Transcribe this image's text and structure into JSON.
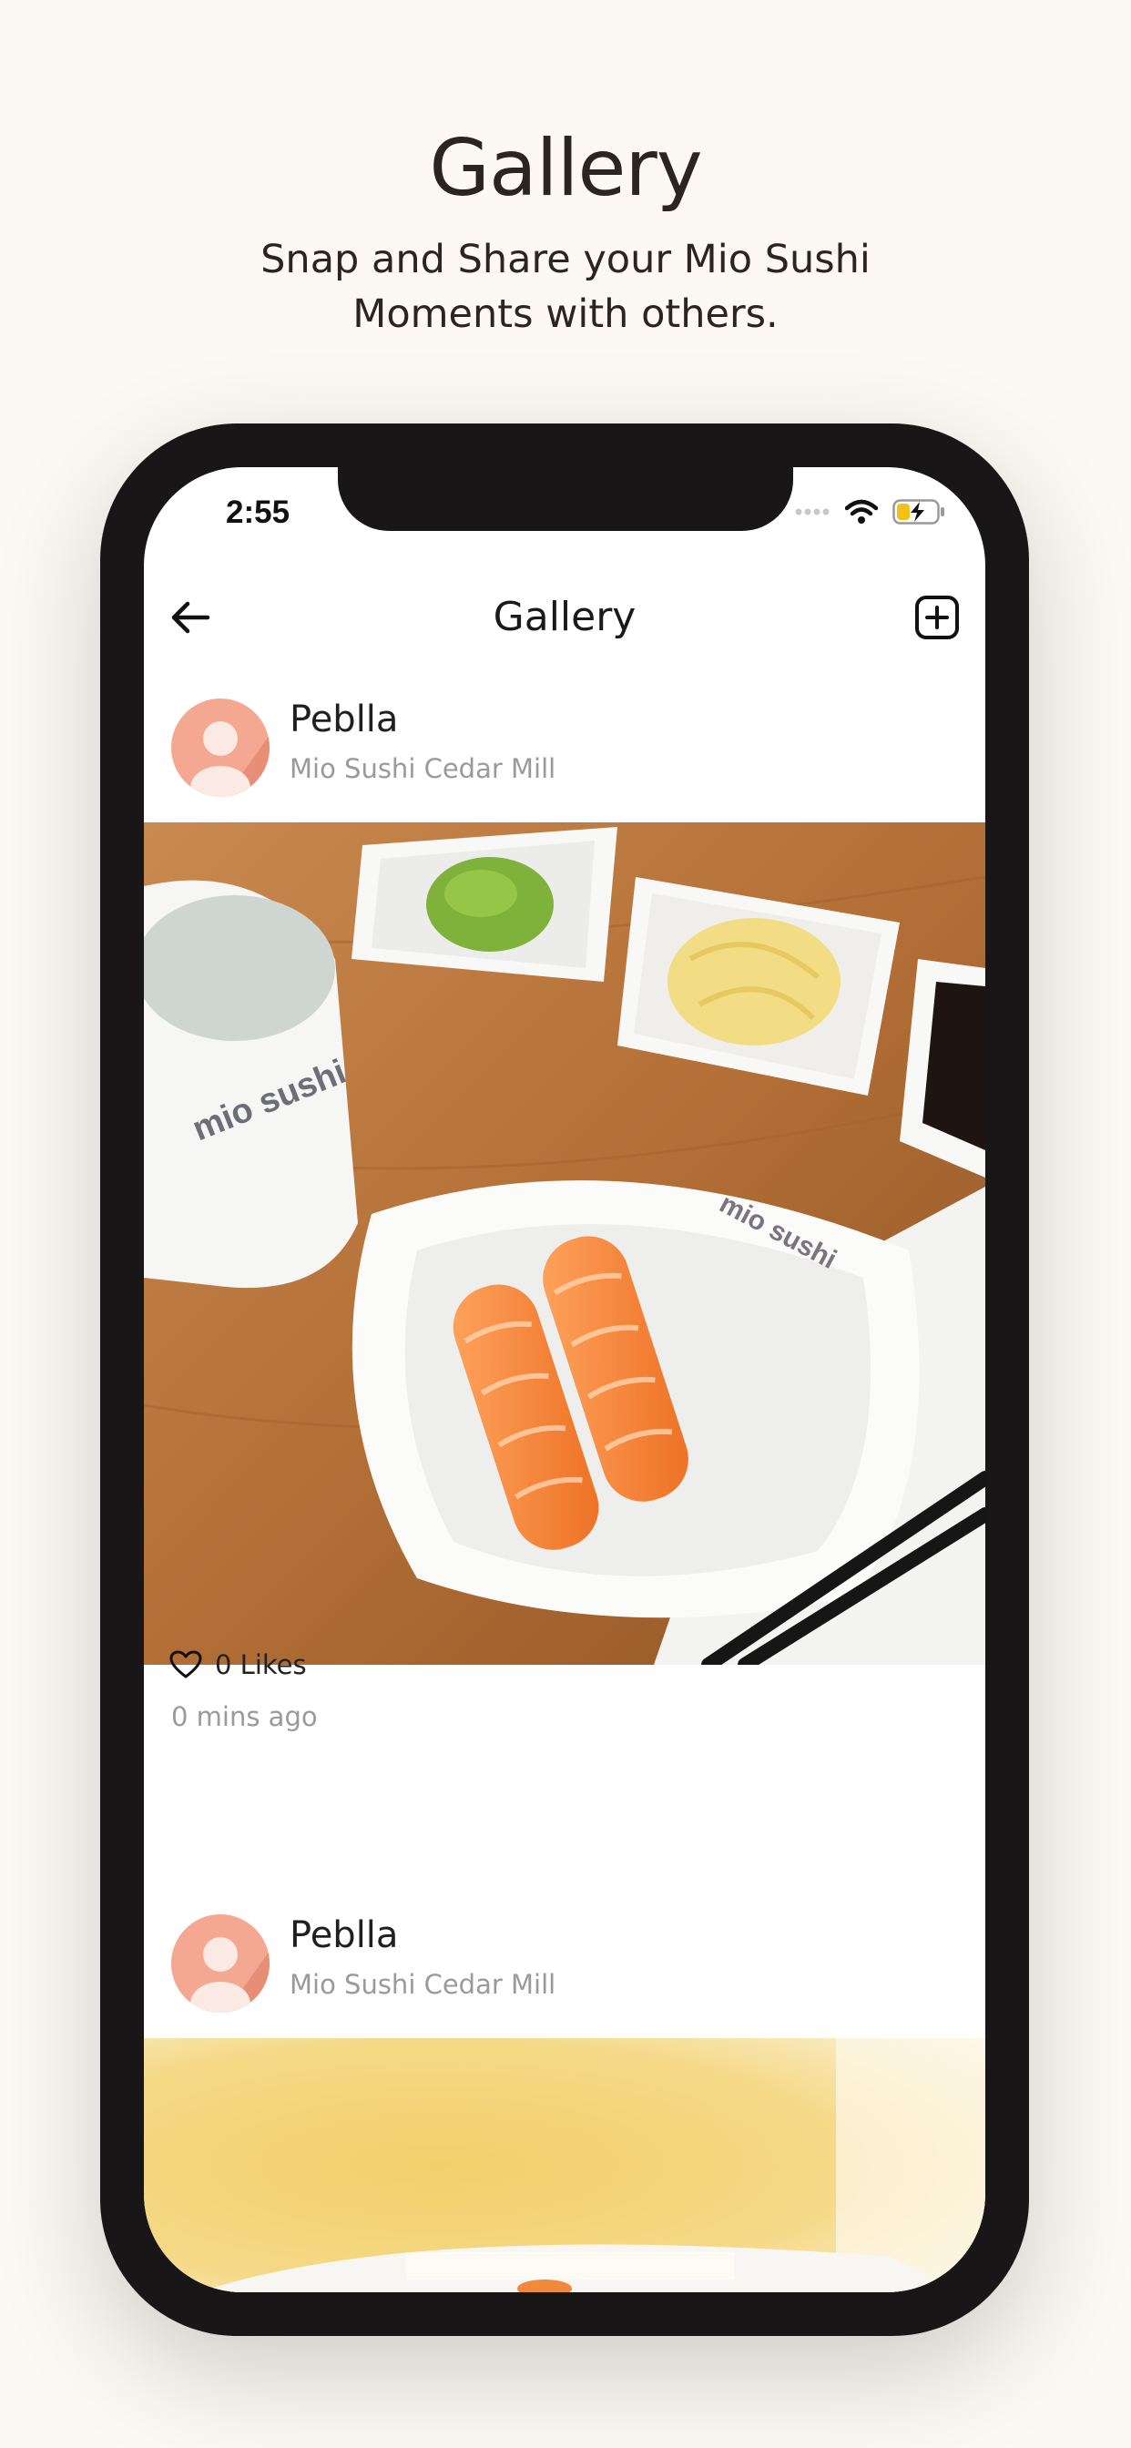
{
  "promo": {
    "title": "Gallery",
    "subtitle_line1": "Snap and Share your Mio Sushi",
    "subtitle_line2": "Moments with others."
  },
  "status_bar": {
    "time": "2:55"
  },
  "nav": {
    "title": "Gallery",
    "back_icon": "arrow-left-icon",
    "add_icon": "plus-square-icon"
  },
  "posts": [
    {
      "user": "Peblla",
      "location": "Mio Sushi Cedar Mill",
      "likes": "0 Likes",
      "time_ago": "0 mins ago",
      "photo_brand_text": "mio sushi"
    },
    {
      "user": "Peblla",
      "location": "Mio Sushi Cedar Mill"
    }
  ],
  "colors": {
    "background": "#fcf9f4",
    "phone_frame": "#181617",
    "avatar": "#f4a892",
    "wood": "#b9773f"
  }
}
